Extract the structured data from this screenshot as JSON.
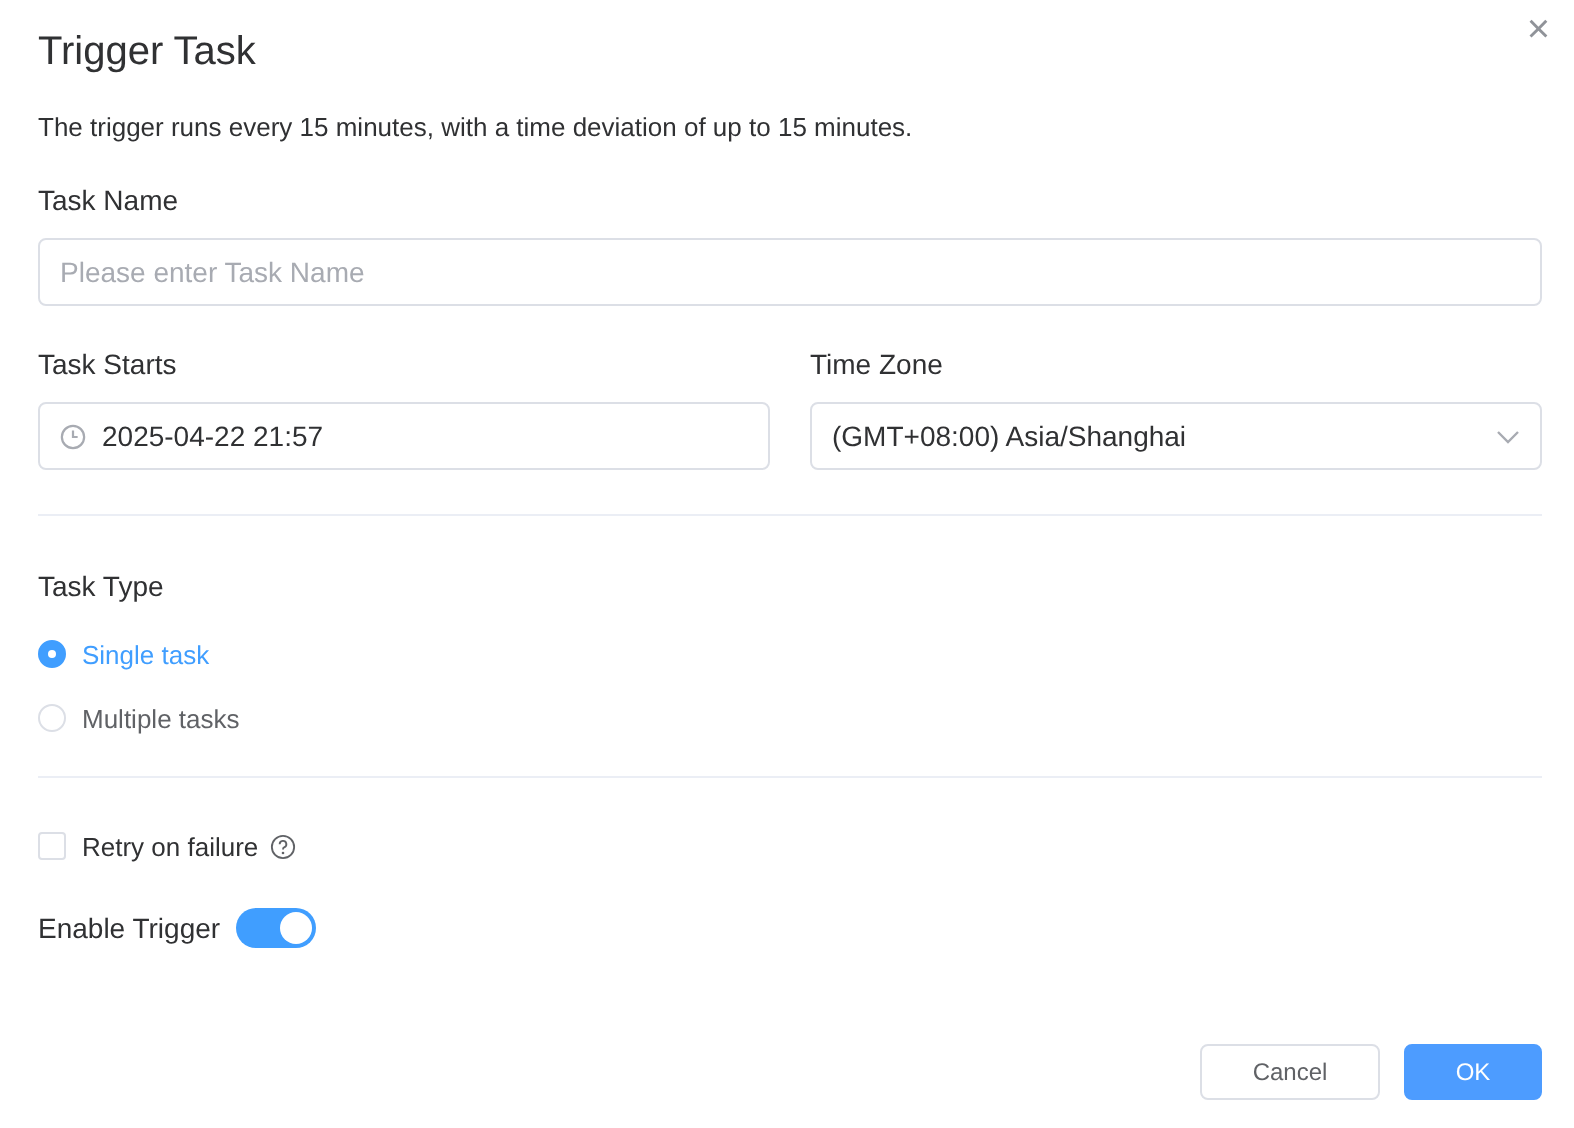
{
  "dialog": {
    "title": "Trigger Task",
    "close": "×",
    "description": "The trigger runs every 15 minutes, with a time deviation of up to 15 minutes."
  },
  "task_name": {
    "label": "Task Name",
    "placeholder": "Please enter Task Name"
  },
  "task_starts": {
    "label": "Task Starts",
    "value": "2025-04-22 21:57"
  },
  "time_zone": {
    "label": "Time Zone",
    "value": "(GMT+08:00) Asia/Shanghai"
  },
  "task_type": {
    "label": "Task Type",
    "options": [
      {
        "label": "Single task",
        "selected": true
      },
      {
        "label": "Multiple tasks",
        "selected": false
      }
    ]
  },
  "retry": {
    "label": "Retry on failure",
    "checked": false
  },
  "enable_trigger": {
    "label": "Enable Trigger",
    "on": true
  },
  "buttons": [
    {
      "label": "Cancel",
      "kind": "secondary"
    },
    {
      "label": "OK",
      "kind": "primary"
    }
  ]
}
